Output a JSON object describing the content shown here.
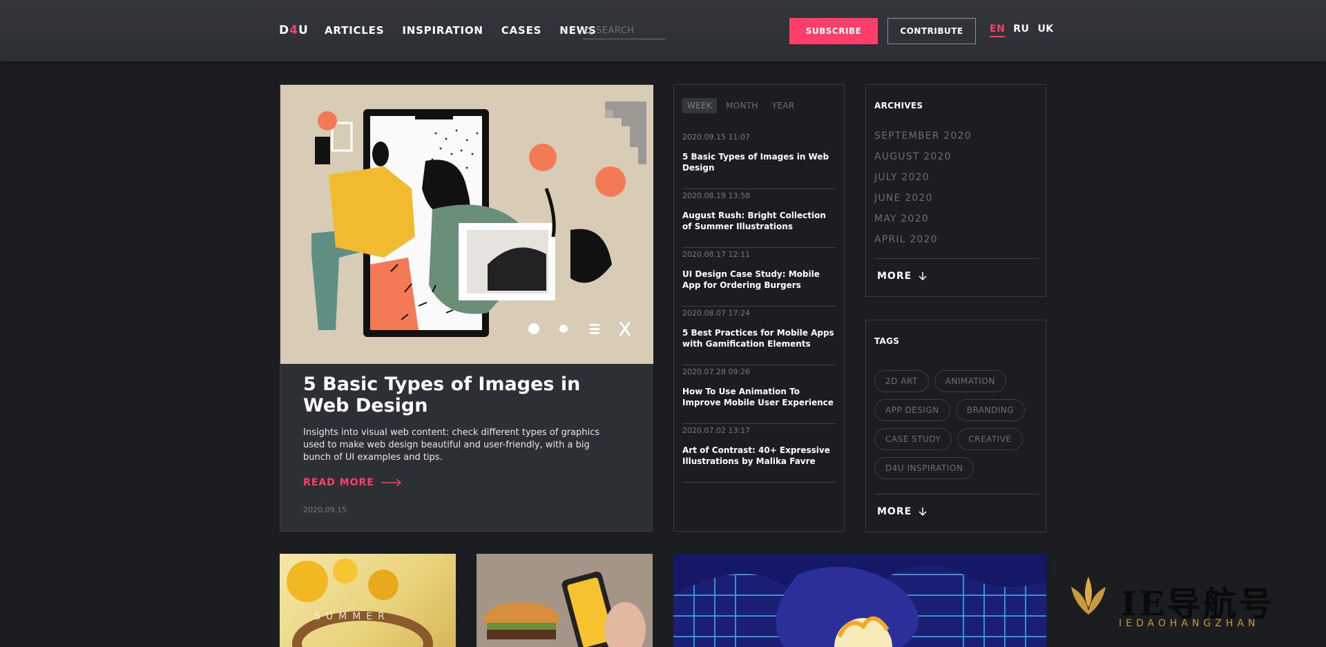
{
  "header": {
    "logo": {
      "part1": "D",
      "part2": "4",
      "part3": "U"
    },
    "nav": [
      "ARTICLES",
      "INSPIRATION",
      "CASES",
      "NEWS"
    ],
    "search_placeholder": "SEARCH",
    "subscribe_label": "SUBSCRIBE",
    "contribute_label": "CONTRIBUTE",
    "languages": [
      "EN",
      "RU",
      "UK"
    ],
    "active_language": "EN"
  },
  "feature": {
    "title": "5 Basic Types of Images in Web Design",
    "description": "Insights into visual web content: check different types of graphics used to make web design beautiful and user-friendly, with a big bunch of UI examples and tips.",
    "read_more": "READ MORE",
    "date": "2020.09.15"
  },
  "latest": {
    "periods": [
      "WEEK",
      "MONTH",
      "YEAR"
    ],
    "active_period": "WEEK",
    "items": [
      {
        "time": "2020.09.15 11:07",
        "title": "5 Basic Types of Images in Web Design"
      },
      {
        "time": "2020.08.19 13:58",
        "title": "August Rush: Bright Collection of Summer Illustrations"
      },
      {
        "time": "2020.08.17 12:11",
        "title": "UI Design Case Study: Mobile App for Ordering Burgers"
      },
      {
        "time": "2020.08.07 17:24",
        "title": "5 Best Practices for Mobile Apps with Gamification Elements"
      },
      {
        "time": "2020.07.28 09:26",
        "title": "How To Use Animation To Improve Mobile User Experience"
      },
      {
        "time": "2020.07.02 13:17",
        "title": "Art of Contrast: 40+ Expressive Illustrations by Malika Favre"
      }
    ]
  },
  "archives": {
    "title": "ARCHIVES",
    "months": [
      "SEPTEMBER 2020",
      "AUGUST 2020",
      "JULY 2020",
      "JUNE 2020",
      "MAY 2020",
      "APRIL 2020"
    ],
    "more": "MORE"
  },
  "tags": {
    "title": "TAGS",
    "items": [
      "2D ART",
      "ANIMATION",
      "APP DESIGN",
      "BRANDING",
      "CASE STUDY",
      "CREATIVE",
      "D4U INSPIRATION"
    ],
    "more": "MORE"
  },
  "thumbs": {
    "summer_text": "SUMMER"
  },
  "watermark": {
    "chars": "IE导航号",
    "sub": "IEDAOHANGZHAN"
  },
  "colors": {
    "accent": "#ff3e6c",
    "background": "#1b1d21",
    "card": "#2c2f34"
  }
}
